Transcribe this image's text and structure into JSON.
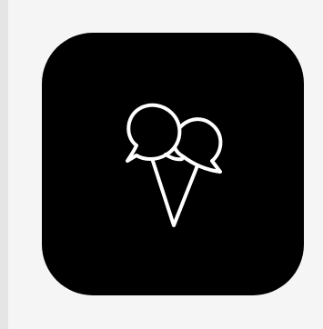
{
  "app_icon": {
    "icon_name": "ice-cream-icon",
    "colors": {
      "page_background": "#f5f5f5",
      "left_edge": "#e5e5e5",
      "tile_background": "#000000",
      "icon_stroke": "#ffffff"
    }
  }
}
